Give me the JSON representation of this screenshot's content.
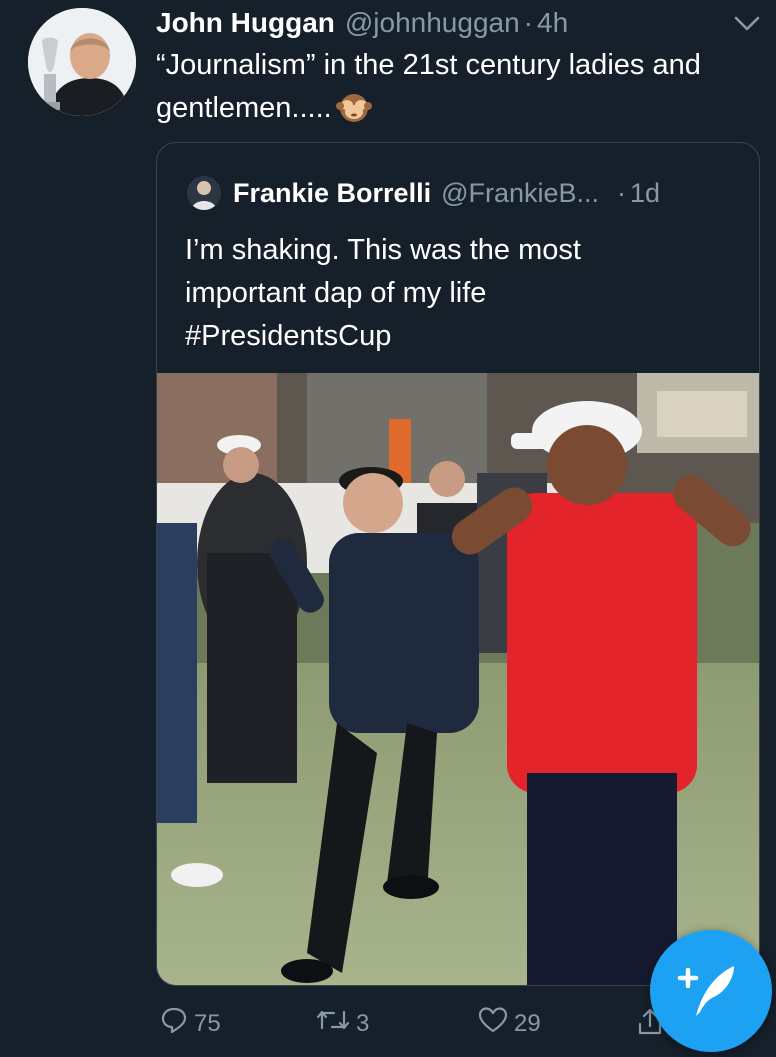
{
  "tweet": {
    "display_name": "John Huggan",
    "handle": "@johnhuggan",
    "separator": "·",
    "time": "4h",
    "text": "“Journalism” in the 21st century ladies and gentlemen.....",
    "emoji": "see-no-evil-monkey"
  },
  "quote": {
    "display_name": "Frankie Borrelli",
    "handle": "@FrankieB...",
    "separator": "·",
    "time": "1d",
    "text_lines": [
      "I’m shaking. This was the most",
      "important dap of my life",
      "#PresidentsCup"
    ],
    "media": "video-still-golf-dap"
  },
  "actions": {
    "reply_count": "75",
    "retweet_count": "3",
    "like_count": "29"
  },
  "icons": {
    "chevron": "chevron-down-icon",
    "reply": "reply-icon",
    "retweet": "retweet-icon",
    "like": "heart-icon",
    "share": "share-icon",
    "compose": "compose-tweet-icon"
  },
  "colors": {
    "background": "#15202b",
    "secondary_text": "#8899a6",
    "border": "#38444d",
    "accent": "#1da1f2"
  }
}
